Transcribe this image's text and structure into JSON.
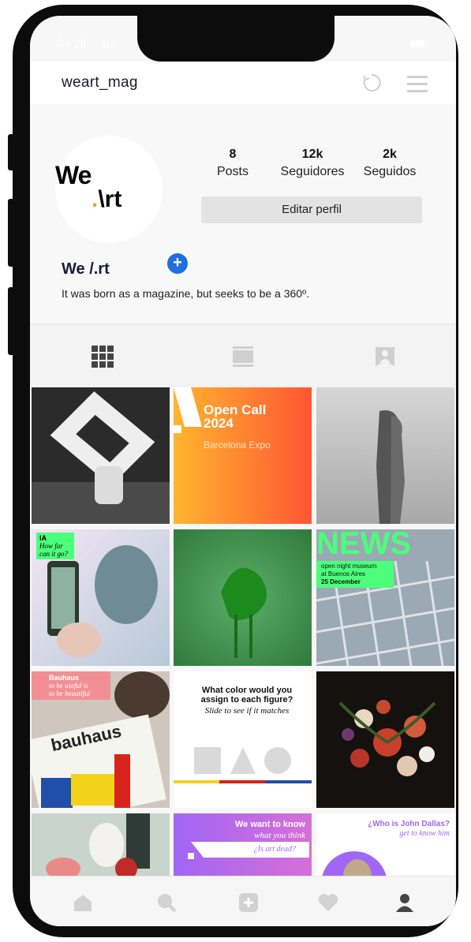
{
  "status_bar": {
    "time": "04:28"
  },
  "header": {
    "username": "weart_mag"
  },
  "profile": {
    "logo_top": "We",
    "logo_bottom_dot": ".",
    "logo_bottom": "\\rt",
    "stats": [
      {
        "value": "8",
        "label": "Posts"
      },
      {
        "value": "12k",
        "label": "Seguidores"
      },
      {
        "value": "2k",
        "label": "Seguidos"
      }
    ],
    "edit_label": "Editar perfil",
    "name": "We /.rt",
    "bio": "It was born as a magazine, but seeks to be a 360º."
  },
  "posts": {
    "open_call": {
      "title": "Open Call",
      "year": "2024",
      "subtitle": "Barcelona Expo"
    },
    "ia": {
      "tag": "IA",
      "text": "How far can it go?"
    },
    "news": {
      "title": "NEWS",
      "line1": "open night museum",
      "line2": "at Buenos Aires",
      "date": "25 December"
    },
    "bauhaus": {
      "title": "Bauhaus",
      "line1": "to be useful is",
      "line2": "to be beautiful",
      "book": "bauhaus"
    },
    "color_quiz": {
      "title": "What color would you assign to each figure?",
      "subtitle": "Slide to see if it matches"
    },
    "we_want": {
      "title": "We want to know",
      "subtitle": "what you think",
      "question": "¿Is art dead?"
    },
    "dallas": {
      "title": "¿Who is John Dallas?",
      "subtitle": "get to know him"
    }
  },
  "colors": {
    "accent_blue": "#1f6fe0",
    "news_green": "#4cff7a",
    "purple": "#a166f5",
    "orange": "#ff5533"
  }
}
